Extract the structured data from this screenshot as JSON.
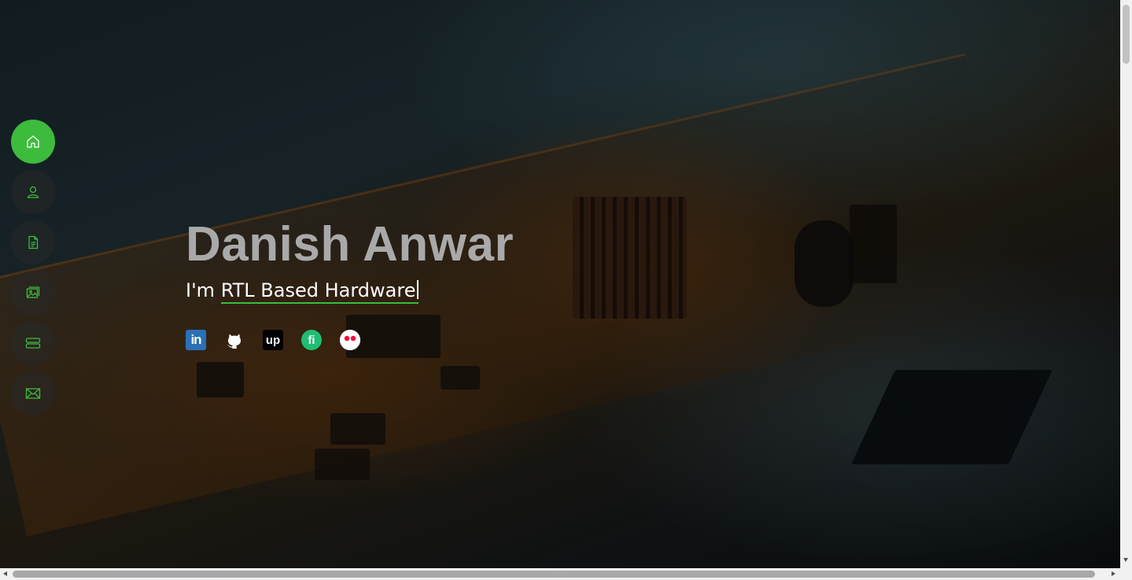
{
  "hero": {
    "name": "Danish Anwar",
    "prefix": "I'm ",
    "typed": "RTL Based Hardware"
  },
  "nav": {
    "items": [
      {
        "icon": "home-icon",
        "active": true
      },
      {
        "icon": "user-icon",
        "active": false
      },
      {
        "icon": "document-icon",
        "active": false
      },
      {
        "icon": "image-icon",
        "active": false
      },
      {
        "icon": "server-icon",
        "active": false
      },
      {
        "icon": "envelope-icon",
        "active": false
      }
    ]
  },
  "socials": {
    "linkedin": "in",
    "upwork": "up",
    "fiverr": "fi"
  },
  "colors": {
    "accent": "#3dbb3d",
    "name": "#a9a9a9"
  }
}
